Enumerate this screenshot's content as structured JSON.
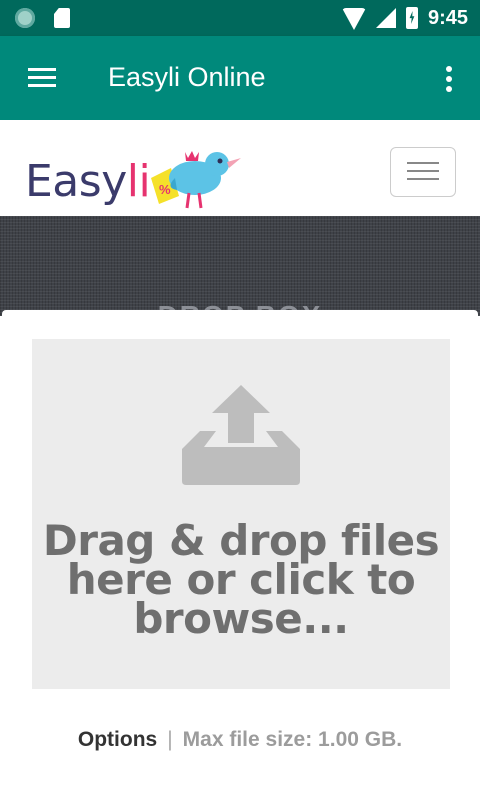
{
  "status_bar": {
    "time": "9:45",
    "icons": [
      "sync-icon",
      "sd-card-icon",
      "wifi-icon",
      "signal-icon",
      "battery-charging-icon"
    ]
  },
  "app_bar": {
    "title": "Easyli Online",
    "menu_icon": "hamburger-menu-icon",
    "overflow_icon": "more-vert-icon",
    "color": "#00897b"
  },
  "site_header": {
    "logo_text_main": "Easy",
    "logo_text_accent": "li",
    "logo_tag_text": "%",
    "nav_toggle_icon": "navbar-toggle-icon"
  },
  "band": {
    "partial_text": "DROP BOX"
  },
  "upload": {
    "icon": "upload-tray-icon",
    "drop_text": "Drag & drop files here or click to browse...",
    "options_label": "Options",
    "separator": "|",
    "max_size_text": "Max file size: 1.00 GB."
  },
  "colors": {
    "status_bar": "#00695c",
    "app_bar": "#00897b",
    "dropzone_bg": "#ececec",
    "logo_primary": "#3b3b6b",
    "logo_accent": "#e6336f"
  }
}
